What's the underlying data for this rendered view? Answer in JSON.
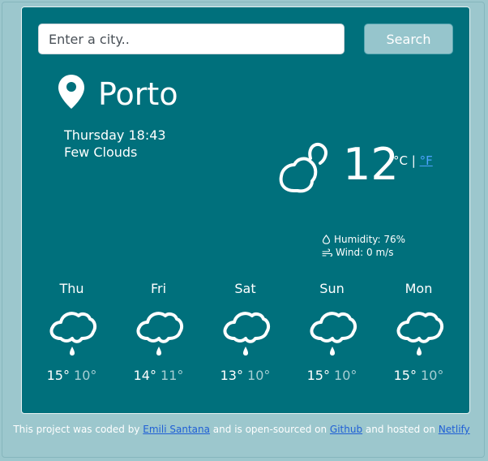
{
  "search": {
    "placeholder": "Enter a city..",
    "value": "",
    "button_label": "Search"
  },
  "current": {
    "city": "Porto",
    "date": "Thursday 18:43",
    "description": "Few Clouds",
    "temperature": "12",
    "unit_c": "°C",
    "separator": "|",
    "unit_f": "°F",
    "humidity": "Humidity: 76%",
    "wind": "Wind: 0 m/s",
    "icon": "few-clouds-icon"
  },
  "forecast": [
    {
      "day": "Thu",
      "max": "15°",
      "min": "10°",
      "icon": "rain-icon"
    },
    {
      "day": "Fri",
      "max": "14°",
      "min": "11°",
      "icon": "rain-icon"
    },
    {
      "day": "Sat",
      "max": "13°",
      "min": "10°",
      "icon": "rain-icon"
    },
    {
      "day": "Sun",
      "max": "15°",
      "min": "10°",
      "icon": "rain-icon"
    },
    {
      "day": "Mon",
      "max": "15°",
      "min": "10°",
      "icon": "rain-icon"
    }
  ],
  "footer": {
    "text1": "This project was coded by",
    "author": "Emili Santana",
    "text2": "and is open-sourced on",
    "github": "Github",
    "text3": "and hosted on",
    "netlify": "Netlify"
  },
  "colors": {
    "background": "#9cc7cd",
    "card": "#00707c",
    "link": "#1f5fd6",
    "min_temp": "#a7cfd4"
  }
}
